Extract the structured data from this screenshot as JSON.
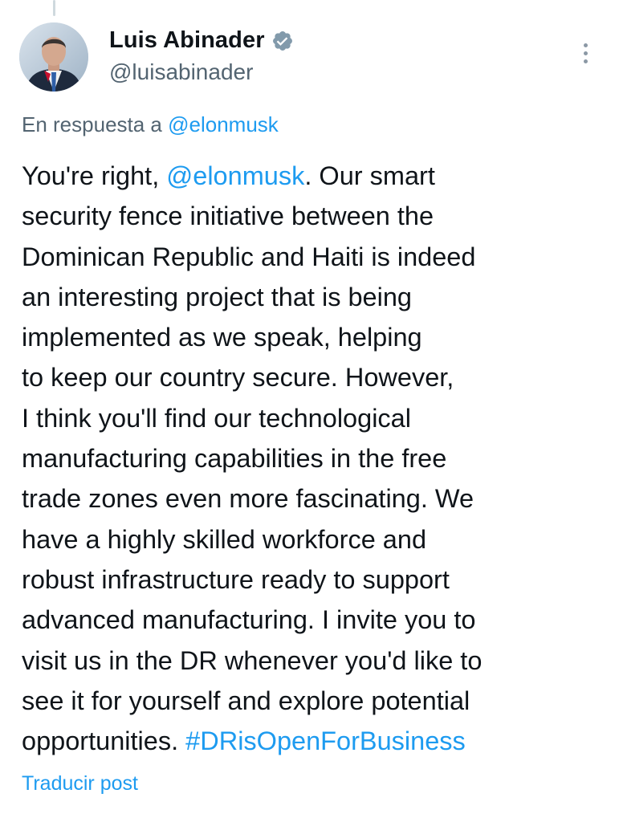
{
  "colors": {
    "text_primary": "#0f1419",
    "text_secondary": "#536471",
    "link": "#1d9bf0",
    "verified_badge": "#829aab"
  },
  "author": {
    "display_name": "Luis Abinader",
    "handle": "@luisabinader",
    "verified_icon": "verified-badge-icon",
    "avatar_icon": "profile-photo"
  },
  "reply_context": {
    "prefix": "En respuesta a ",
    "mention": "@elonmusk"
  },
  "tweet": {
    "line_1": {
      "before": "You're right, ",
      "mention": "@elonmusk",
      "after": ". Our smart"
    },
    "line_2": "security fence initiative between the",
    "line_3": "Dominican Republic and Haiti is indeed",
    "line_4": "an interesting project that is being",
    "line_5": "implemented as we speak, helping",
    "line_6": "to keep our country secure. However,",
    "line_7": "I think you'll find our technological",
    "line_8": "manufacturing capabilities in the free",
    "line_9": "trade zones even more fascinating. We",
    "line_10": "have a highly skilled workforce and",
    "line_11": "robust infrastructure ready to support",
    "line_12": "advanced manufacturing. I invite you to",
    "line_13": "visit us in the DR whenever you'd like to",
    "line_14": "see it for yourself and explore potential",
    "line_15": {
      "before": "opportunities. ",
      "hashtag": "#DRisOpenForBusiness"
    }
  },
  "actions": {
    "translate_label": "Traducir post",
    "more_icon": "more-vertical-icon"
  }
}
